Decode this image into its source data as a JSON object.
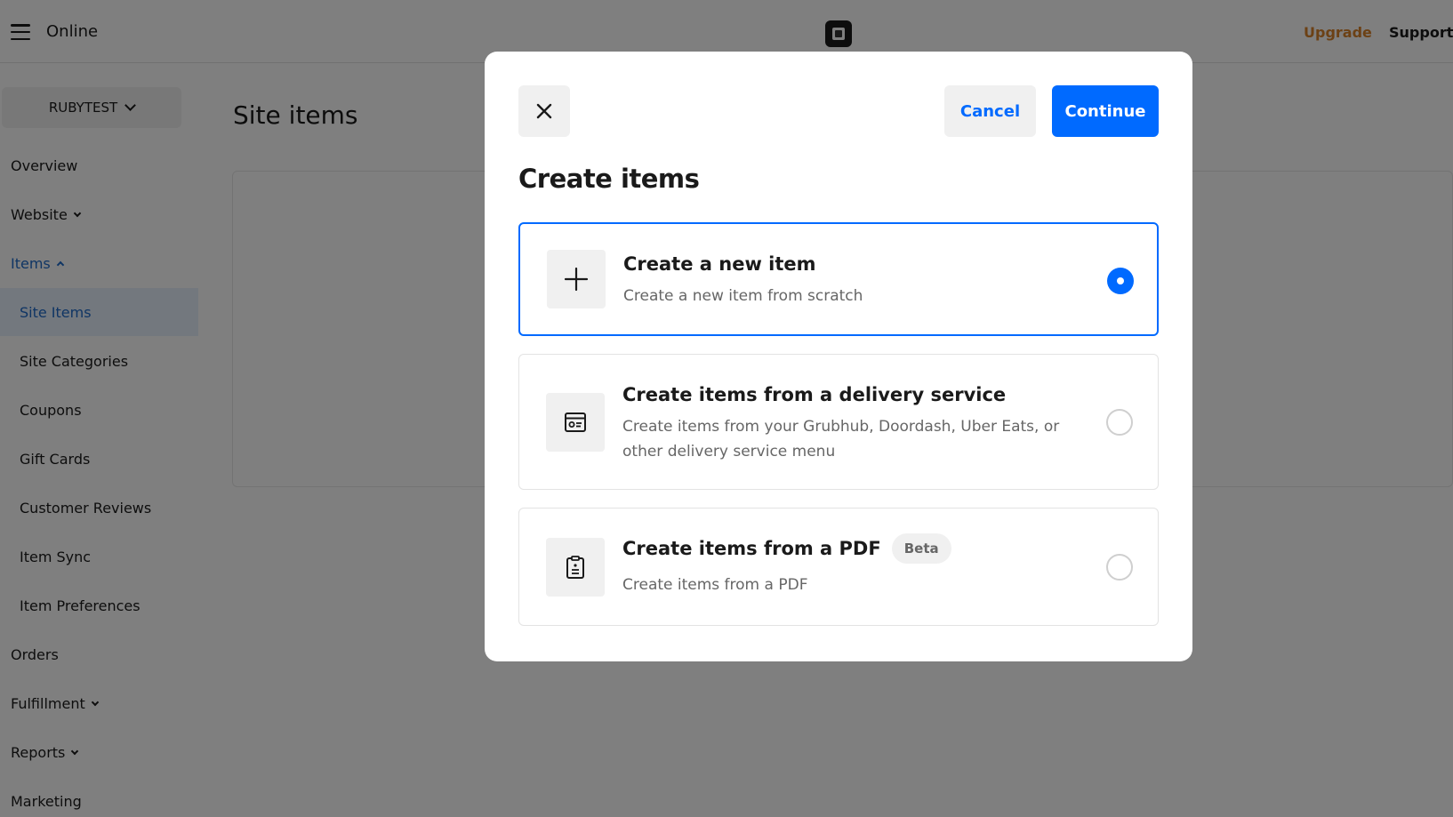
{
  "topbar": {
    "app_label": "Online",
    "upgrade_label": "Upgrade",
    "support_label": "Support"
  },
  "sidebar": {
    "site_selector": "RUBYTEST",
    "items": [
      {
        "label": "Overview"
      },
      {
        "label": "Website"
      },
      {
        "label": "Items"
      },
      {
        "label": "Site Items"
      },
      {
        "label": "Site Categories"
      },
      {
        "label": "Coupons"
      },
      {
        "label": "Gift Cards"
      },
      {
        "label": "Customer Reviews"
      },
      {
        "label": "Item Sync"
      },
      {
        "label": "Item Preferences"
      },
      {
        "label": "Orders"
      },
      {
        "label": "Fulfillment"
      },
      {
        "label": "Reports"
      },
      {
        "label": "Marketing"
      }
    ]
  },
  "main": {
    "title": "Site items"
  },
  "modal": {
    "title": "Create items",
    "cancel_label": "Cancel",
    "continue_label": "Continue",
    "options": [
      {
        "title": "Create a new item",
        "description": "Create a new item from scratch",
        "selected": true
      },
      {
        "title": "Create items from a delivery service",
        "description": "Create items from your Grubhub, Doordash, Uber Eats, or other delivery service menu",
        "selected": false
      },
      {
        "title": "Create items from a PDF",
        "badge": "Beta",
        "description": "Create items from a PDF",
        "selected": false
      }
    ]
  },
  "colors": {
    "primary": "#006aff",
    "upgrade": "#d9822b",
    "nav_active": "#1f6ac9"
  },
  "icons": {
    "close": "close-icon",
    "menu": "hamburger-icon",
    "logo": "square-logo-icon",
    "new_item": "plus-icon",
    "delivery": "storefront-icon",
    "pdf": "document-icon"
  }
}
